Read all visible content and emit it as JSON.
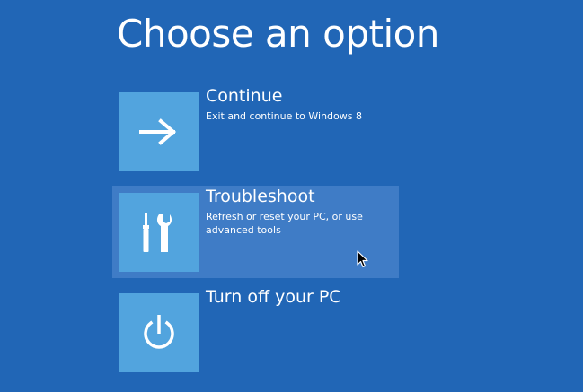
{
  "page": {
    "title": "Choose an option"
  },
  "options": [
    {
      "id": "continue",
      "icon": "arrow-right-icon",
      "label": "Continue",
      "description": "Exit and continue to Windows 8"
    },
    {
      "id": "troubleshoot",
      "icon": "tools-icon",
      "label": "Troubleshoot",
      "description": "Refresh or reset your PC, or use advanced tools"
    },
    {
      "id": "turn-off",
      "icon": "power-icon",
      "label": "Turn off your PC",
      "description": ""
    }
  ],
  "colors": {
    "background": "#2166b6",
    "tile": "#52a4de",
    "hover": "#3f7cc6",
    "text": "#ffffff"
  }
}
